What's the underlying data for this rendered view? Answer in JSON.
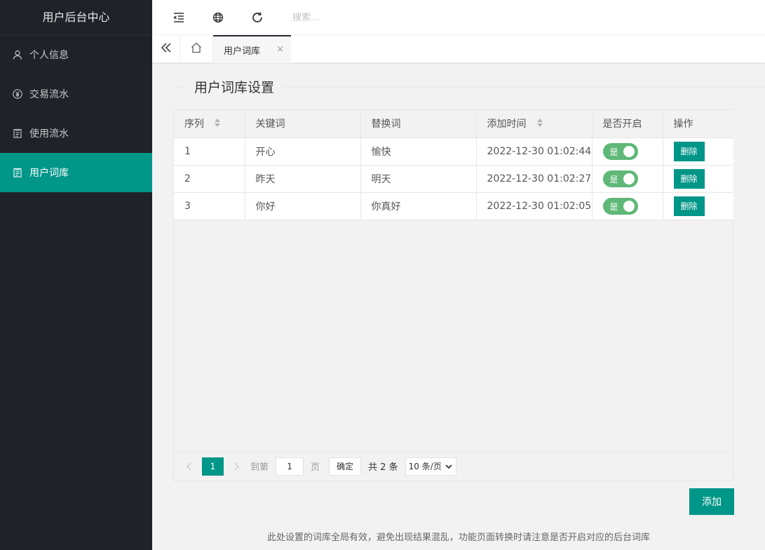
{
  "sidebar": {
    "title": "用户后台中心",
    "items": [
      {
        "label": "个人信息",
        "icon": "user-icon"
      },
      {
        "label": "交易流水",
        "icon": "yen-icon"
      },
      {
        "label": "使用流水",
        "icon": "document-icon"
      },
      {
        "label": "用户词库",
        "icon": "document-icon"
      }
    ],
    "active_index": 3,
    "active_color": "#009688"
  },
  "header": {
    "search_placeholder": "搜索..."
  },
  "tabs": {
    "active_label": "用户词库",
    "close": "×"
  },
  "page": {
    "legend": "用户词库设置"
  },
  "table": {
    "columns": [
      "序列",
      "关键词",
      "替换词",
      "添加时间",
      "是否开启",
      "操作"
    ],
    "rows": [
      {
        "index": "1",
        "keyword": "开心",
        "replacement": "愉快",
        "added": "2022-12-30 01:02:44",
        "enabled": "是",
        "action": "删除"
      },
      {
        "index": "2",
        "keyword": "昨天",
        "replacement": "明天",
        "added": "2022-12-30 01:02:27",
        "enabled": "是",
        "action": "删除"
      },
      {
        "index": "3",
        "keyword": "你好",
        "replacement": "你真好",
        "added": "2022-12-30 01:02:05",
        "enabled": "是",
        "action": "删除"
      }
    ]
  },
  "pager": {
    "current": "1",
    "goto_label": "到第",
    "goto_value": "1",
    "page_label": "页",
    "confirm": "确定",
    "total": "共 2 条",
    "per_page": "10 条/页"
  },
  "add_button": "添加",
  "footer_note": "此处设置的词库全局有效，避免出现结果混乱，功能页面转换时请注意是否开启对应的后台词库",
  "colors": {
    "sidebar_bg": "#20222a",
    "accent": "#009688",
    "toggle_on": "#5fb878"
  }
}
